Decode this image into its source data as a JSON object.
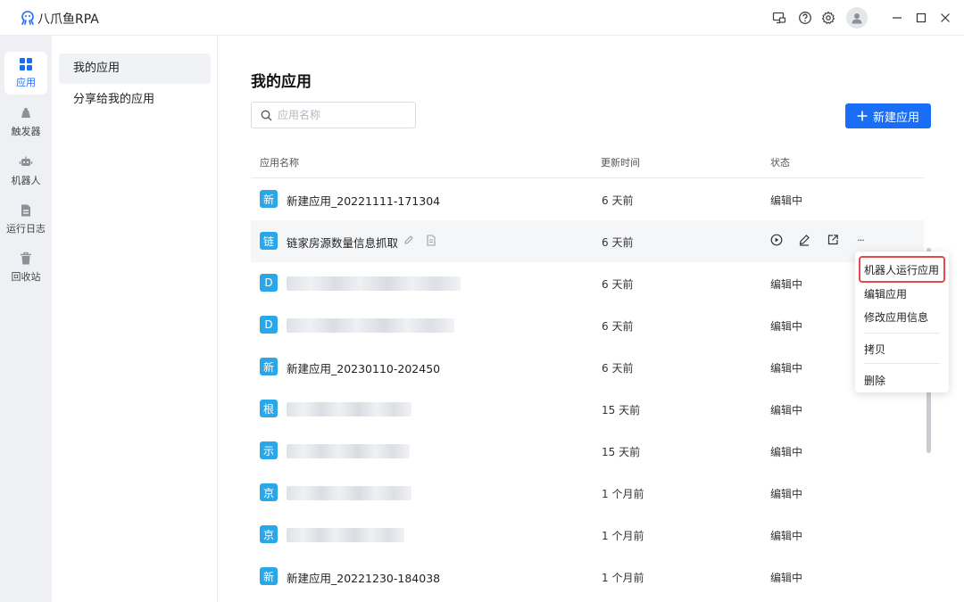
{
  "app": {
    "name": "八爪鱼RPA"
  },
  "rail": [
    {
      "label": "应用",
      "icon": "apps-grid-icon",
      "active": true
    },
    {
      "label": "触发器",
      "icon": "trigger-icon"
    },
    {
      "label": "机器人",
      "icon": "robot-icon"
    },
    {
      "label": "运行日志",
      "icon": "log-icon"
    },
    {
      "label": "回收站",
      "icon": "trash-icon"
    }
  ],
  "subnav": [
    {
      "label": "我的应用",
      "active": true
    },
    {
      "label": "分享给我的应用"
    }
  ],
  "main": {
    "title": "我的应用",
    "search_placeholder": "应用名称",
    "new_button": "新建应用",
    "columns": {
      "name": "应用名称",
      "updated": "更新时间",
      "status": "状态"
    }
  },
  "rows": [
    {
      "badge": "新",
      "name": "新建应用_20221111-171304",
      "time": "6 天前",
      "status": "编辑中"
    },
    {
      "badge": "链",
      "name": "链家房源数量信息抓取",
      "time": "6 天前",
      "status": ""
    },
    {
      "badge": "D",
      "name": "",
      "time": "6 天前",
      "status": "编辑中"
    },
    {
      "badge": "D",
      "name": "",
      "time": "6 天前",
      "status": "编辑中"
    },
    {
      "badge": "新",
      "name": "新建应用_20230110-202450",
      "time": "6 天前",
      "status": "编辑中"
    },
    {
      "badge": "根",
      "name": "",
      "time": "15 天前",
      "status": "编辑中"
    },
    {
      "badge": "示",
      "name": "",
      "time": "15 天前",
      "status": "编辑中"
    },
    {
      "badge": "京",
      "name": "",
      "time": "1 个月前",
      "status": "编辑中"
    },
    {
      "badge": "京",
      "name": "",
      "time": "1 个月前",
      "status": "编辑中"
    },
    {
      "badge": "新",
      "name": "新建应用_20221230-184038",
      "time": "1 个月前",
      "status": "编辑中"
    }
  ],
  "menu": {
    "run": "机器人运行应用",
    "edit": "编辑应用",
    "modify": "修改应用信息",
    "copy": "拷贝",
    "delete": "删除"
  },
  "more_label": "···",
  "colors": {
    "primary": "#1a6ef5",
    "badge": "#2aa7e8",
    "highlight": "#e34b4b"
  }
}
